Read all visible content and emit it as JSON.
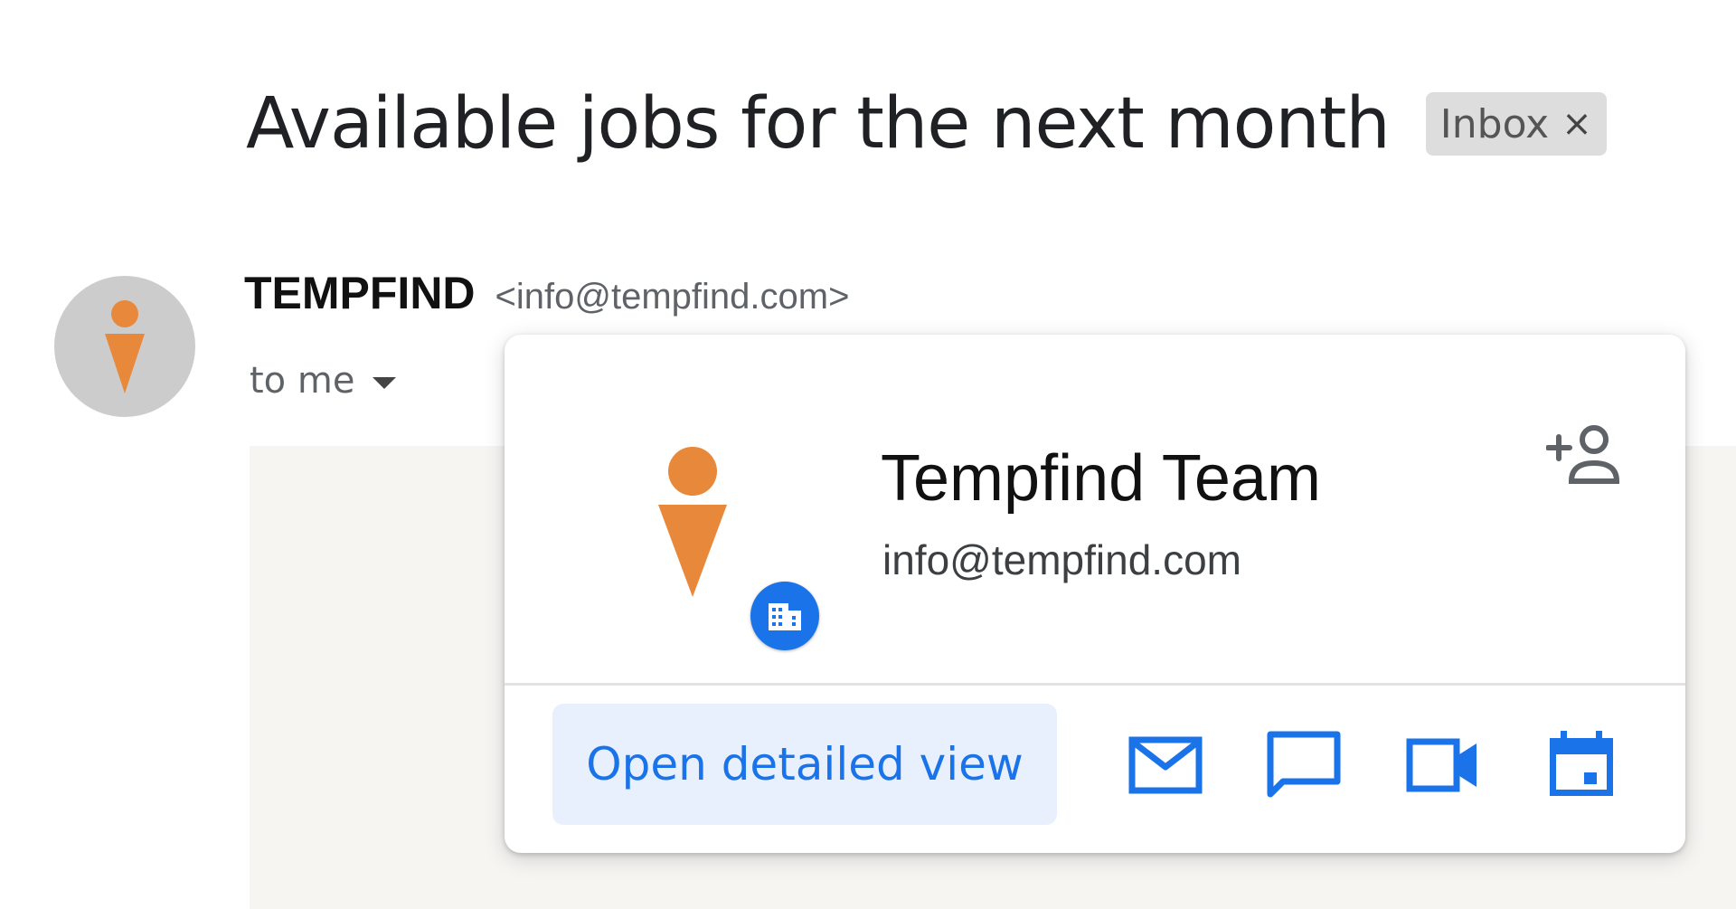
{
  "thread": {
    "subject": "Available jobs for the next month",
    "label": "Inbox",
    "label_remove_icon": "×"
  },
  "sender": {
    "name": "TEMPFIND",
    "email": "<info@tempfind.com>",
    "recipient_text": "to me",
    "avatar_icon": "tempfind-logo-icon"
  },
  "contact_card": {
    "name": "Tempfind Team",
    "email": "info@tempfind.com",
    "badge_icon": "building-icon",
    "add_contact_icon": "add-person-icon",
    "primary_action": "Open detailed view",
    "actions": [
      "mail-icon",
      "chat-icon",
      "video-call-icon",
      "calendar-icon"
    ]
  },
  "colors": {
    "brand_orange": "#e8883a",
    "accent_blue": "#1a73e8",
    "avatar_gray": "#cccccc",
    "button_bg": "#e8f0fe"
  }
}
